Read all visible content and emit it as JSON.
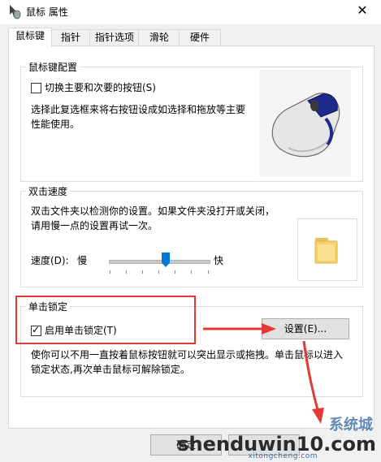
{
  "window": {
    "title": "鼠标 属性",
    "close_glyph": "✕"
  },
  "tabs": [
    {
      "label": "鼠标键",
      "active": true
    },
    {
      "label": "指针",
      "active": false
    },
    {
      "label": "指针选项",
      "active": false
    },
    {
      "label": "滑轮",
      "active": false
    },
    {
      "label": "硬件",
      "active": false
    }
  ],
  "button_config": {
    "title": "鼠标键配置",
    "switch_label": "切换主要和次要的按钮(S)",
    "switch_checked": false,
    "description": "选择此复选框来将右按钮设成如选择和拖放等主要性能使用。"
  },
  "double_click": {
    "title": "双击速度",
    "description": "双击文件夹以检测你的设置。如果文件夹没打开或关闭，请用慢一点的设置再试一次。",
    "speed_label": "速度(D):",
    "slow": "慢",
    "fast": "快",
    "speed_fraction": 0.57
  },
  "click_lock": {
    "title": "单击锁定",
    "enable_label": "启用单击锁定(T)",
    "enable_checked": true,
    "settings_button": "设置(E)...",
    "description": "使你可以不用一直按着鼠标按钮就可以突出显示或拖拽。单击鼠标以进入锁定状态,再次单击鼠标可解除锁定。"
  },
  "footer": {
    "ok_button": "确定"
  },
  "watermark": {
    "main": "shenduwin10.com",
    "sub": "xitongcheng.com",
    "cn": "系统城"
  },
  "colors": {
    "annotation_red": "#e53935",
    "slider_blue": "#0078d7",
    "folder_yellow": "#f4d26b"
  }
}
